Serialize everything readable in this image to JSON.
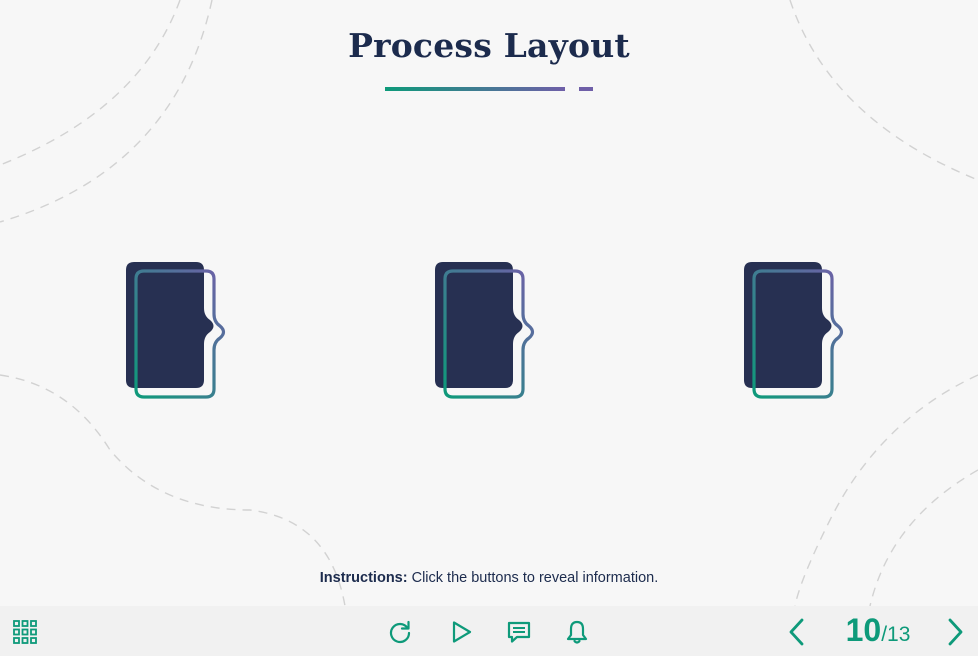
{
  "title": "Process Layout",
  "colors": {
    "navy": "#273052",
    "teal": "#0e9a7a",
    "purple": "#6f5fa8",
    "title_text": "#1c2b4d",
    "background": "#f7f7f7"
  },
  "process_items": [
    {
      "icon": "document-tab-icon"
    },
    {
      "icon": "document-tab-icon"
    },
    {
      "icon": "document-tab-icon"
    }
  ],
  "instructions": {
    "label": "Instructions:",
    "text": " Click the buttons to reveal information."
  },
  "footer": {
    "menu_icon": "grid-menu-icon",
    "center_controls": [
      "replay-icon",
      "play-icon",
      "comment-icon",
      "bell-icon"
    ],
    "page": {
      "current": "10",
      "separator": "/",
      "total": "13"
    },
    "prev_icon": "chevron-left-icon",
    "next_icon": "chevron-right-icon"
  }
}
